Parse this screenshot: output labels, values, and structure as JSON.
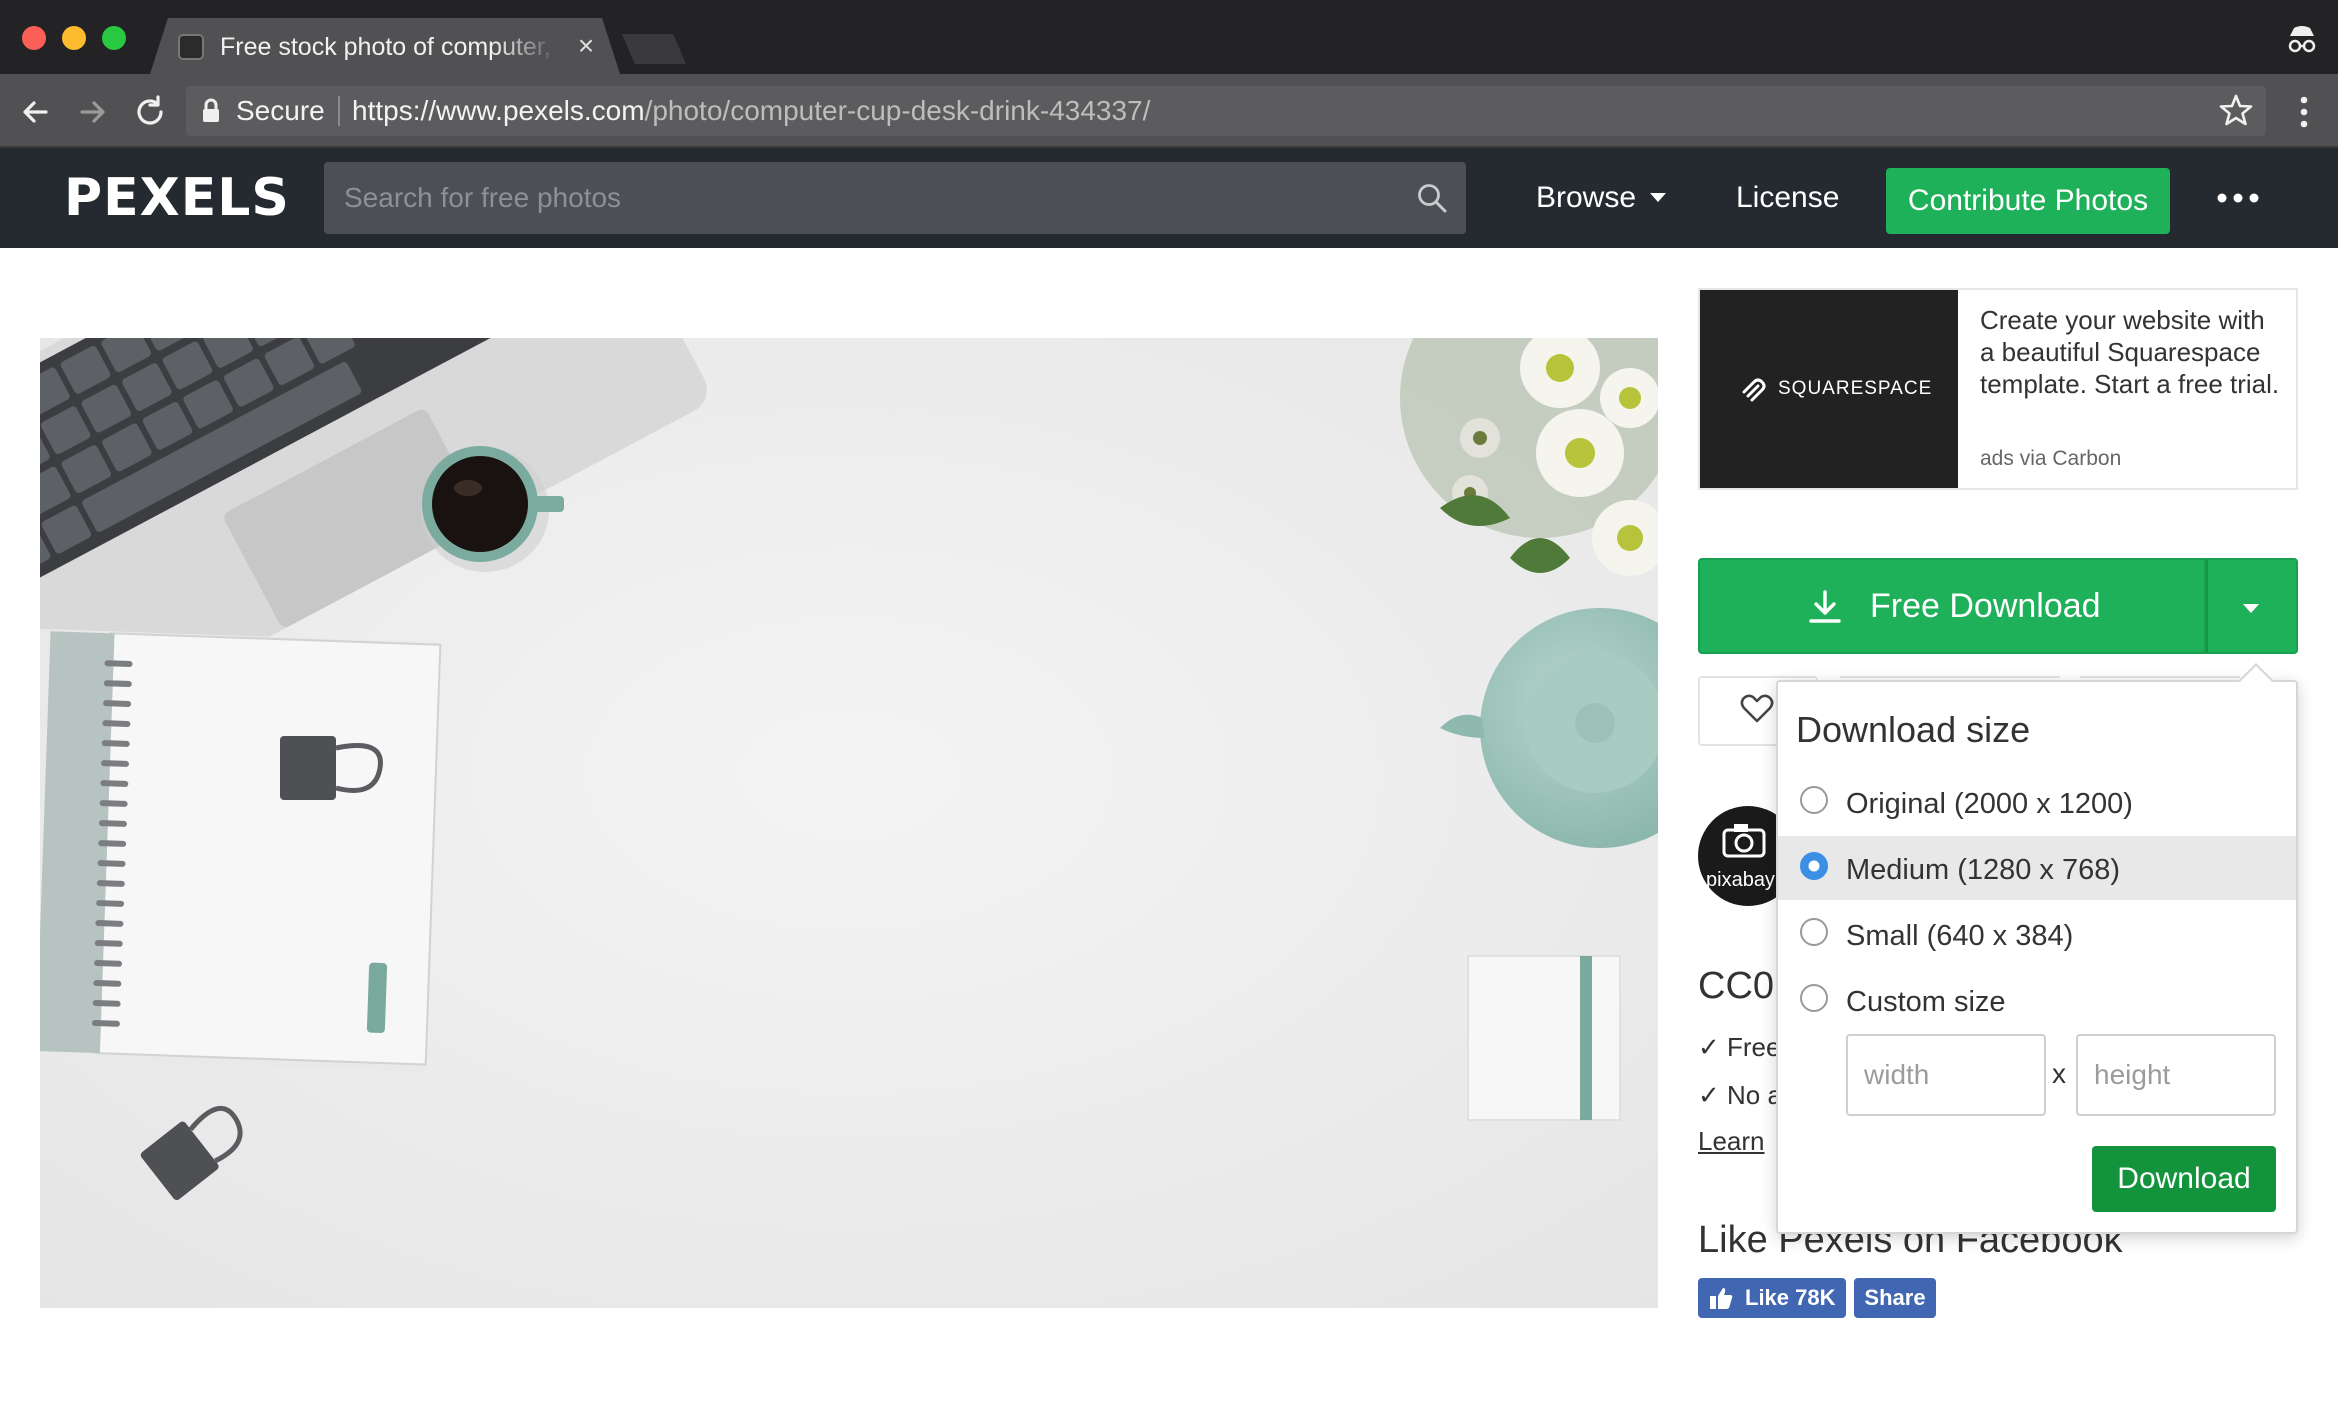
{
  "browser": {
    "tab_title": "Free stock photo of computer, cup, desk",
    "secure_label": "Secure",
    "url_host": "https://www.pexels.com",
    "url_path": "/photo/computer-cup-desk-drink-434337/"
  },
  "header": {
    "logo": "PEXELS",
    "search_placeholder": "Search for free photos",
    "browse_label": "Browse",
    "license_label": "License",
    "contribute_label": "Contribute Photos"
  },
  "ad": {
    "brand": "SQUARESPACE",
    "text": "Create your website with a beautiful Squarespace template. Start a free trial.",
    "via": "ads via Carbon"
  },
  "download": {
    "button_label": "Free Download",
    "popover_title": "Download size",
    "options": [
      {
        "label": "Original (2000 x 1200)",
        "selected": false
      },
      {
        "label": "Medium (1280 x 768)",
        "selected": true
      },
      {
        "label": "Small (640 x 384)",
        "selected": false
      },
      {
        "label": "Custom size",
        "selected": false
      }
    ],
    "width_placeholder": "width",
    "height_placeholder": "height",
    "times": "x",
    "submit_label": "Download"
  },
  "photographer": {
    "name": "pixabay"
  },
  "license": {
    "title": "CC0",
    "line1": "✓ Free",
    "line2": "✓ No a",
    "learn": "Learn"
  },
  "facebook": {
    "title": "Like Pexels on Facebook",
    "like_label": "Like 78K",
    "share_label": "Share"
  },
  "colors": {
    "brand_green": "#1fb15a",
    "header_bg": "#252a31",
    "facebook_blue": "#4267b2",
    "radio_blue": "#3b8fe4"
  }
}
